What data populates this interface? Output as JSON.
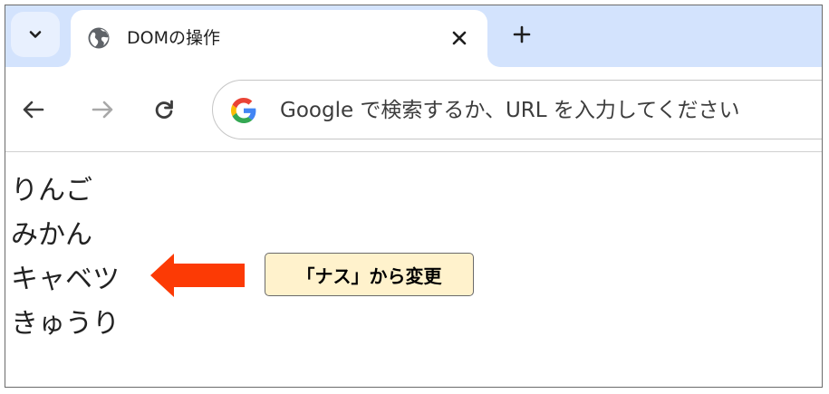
{
  "tab_strip": {
    "tab_search_icon": "chevron-down-icon",
    "active_tab": {
      "title": "DOMの操作",
      "favicon": "globe-icon",
      "close_icon": "close-icon"
    },
    "new_tab_icon": "plus-icon"
  },
  "toolbar": {
    "back_icon": "arrow-left-icon",
    "forward_icon": "arrow-right-icon",
    "reload_icon": "reload-icon",
    "omnibox": {
      "icon": "google-g-icon",
      "placeholder": "Google で検索するか、URL を入力してください"
    }
  },
  "page": {
    "items": [
      "りんご",
      "みかん",
      "キャベツ",
      "きゅうり"
    ],
    "annotation": {
      "text": "「ナス」から変更",
      "arrow_color": "#fc3a05",
      "box_color": "#fff2cc"
    }
  },
  "colors": {
    "tab_strip_bg": "#d3e3fd",
    "toolbar_bg": "#ffffff"
  }
}
